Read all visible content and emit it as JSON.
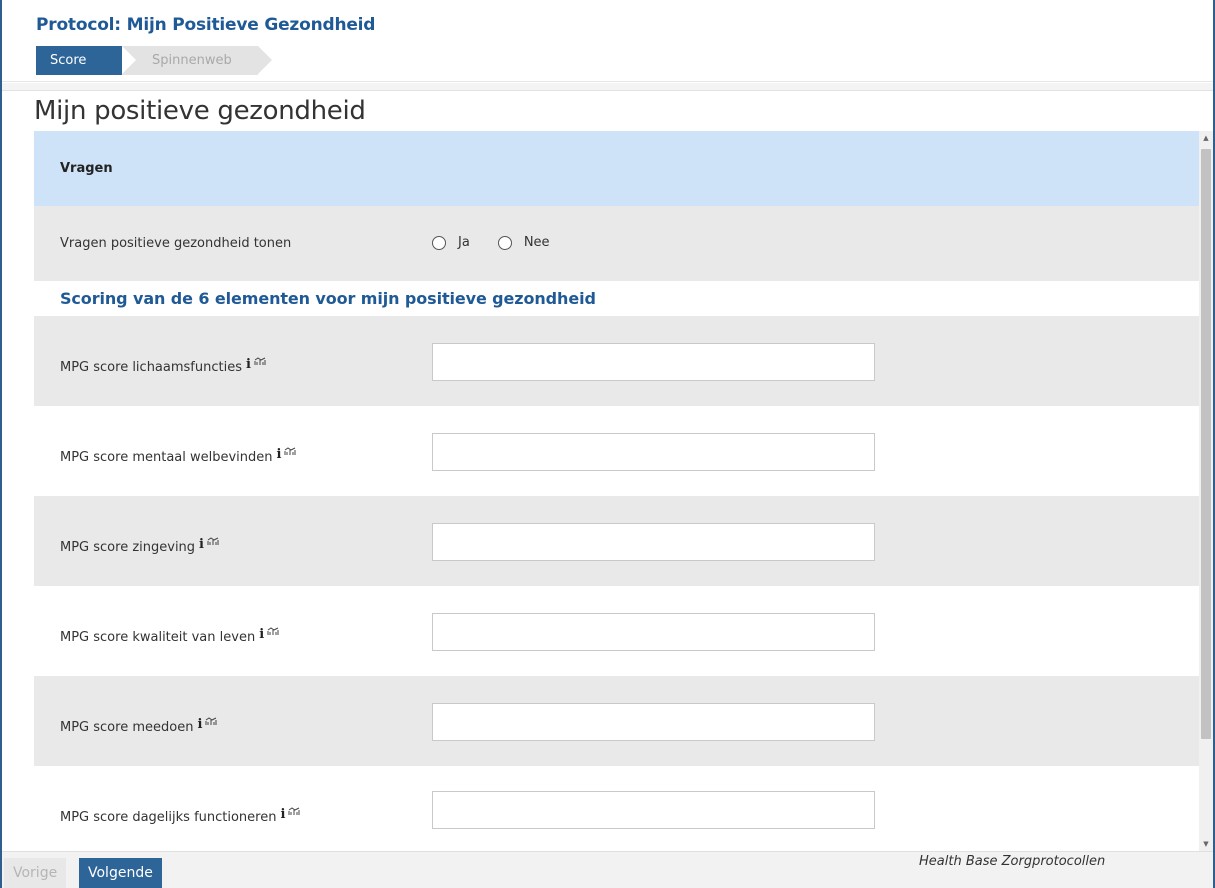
{
  "header": {
    "protocol_title": "Protocol: Mijn Positieve Gezondheid",
    "steps": [
      {
        "label": "Score",
        "active": true
      },
      {
        "label": "Spinnenweb",
        "active": false
      }
    ]
  },
  "page": {
    "title": "Mijn positieve gezondheid"
  },
  "section": {
    "title": "Vragen"
  },
  "question": {
    "label": "Vragen positieve gezondheid tonen",
    "options": [
      "Ja",
      "Nee"
    ]
  },
  "scoring": {
    "title": "Scoring van de 6 elementen voor mijn positieve gezondheid",
    "info_glyph": "i",
    "fields": [
      {
        "label": "MPG score lichaamsfuncties",
        "value": ""
      },
      {
        "label": "MPG score mentaal welbevinden",
        "value": ""
      },
      {
        "label": "MPG score zingeving",
        "value": ""
      },
      {
        "label": "MPG score kwaliteit van leven",
        "value": ""
      },
      {
        "label": "MPG score meedoen",
        "value": ""
      },
      {
        "label": "MPG score dagelijks functioneren",
        "value": ""
      }
    ]
  },
  "footer": {
    "prev_label": "Vorige",
    "next_label": "Volgende",
    "brand": "Health Base Zorgprotocollen"
  },
  "colors": {
    "brand_blue": "#1f5a96",
    "step_active": "#2e6598",
    "section_bg": "#cfe3f8",
    "row_grey": "#e9e9e9"
  },
  "icons": {
    "info": "info-icon",
    "chart": "chart-icon",
    "scroll_up": "scroll-up-arrow-icon",
    "scroll_down": "scroll-down-arrow-icon"
  }
}
